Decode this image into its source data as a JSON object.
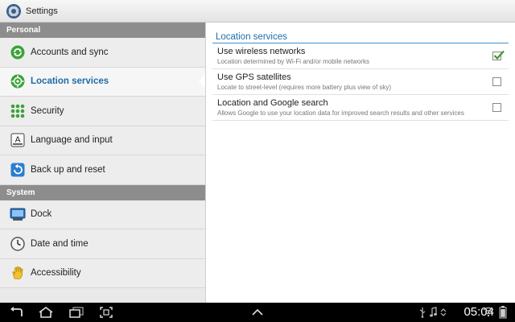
{
  "app": {
    "title": "Settings",
    "icon": "settings-gear-icon"
  },
  "sidebar": {
    "sections": [
      {
        "header": "Personal",
        "items": [
          {
            "label": "Accounts and sync",
            "icon": "sync-icon"
          },
          {
            "label": "Location services",
            "icon": "location-target-icon",
            "selected": true
          },
          {
            "label": "Security",
            "icon": "security-grid-icon"
          },
          {
            "label": "Language and input",
            "icon": "keyboard-a-icon"
          },
          {
            "label": "Back up and reset",
            "icon": "backup-reset-icon"
          }
        ]
      },
      {
        "header": "System",
        "items": [
          {
            "label": "Dock",
            "icon": "dock-icon"
          },
          {
            "label": "Date and time",
            "icon": "clock-icon"
          },
          {
            "label": "Accessibility",
            "icon": "hand-icon"
          }
        ]
      }
    ]
  },
  "main": {
    "title": "Location services",
    "prefs": [
      {
        "title": "Use wireless networks",
        "summary": "Location determined by Wi-Fi and/or mobile networks",
        "checked": true
      },
      {
        "title": "Use GPS satellites",
        "summary": "Locate to street-level (requires more battery plus view of sky)",
        "checked": false
      },
      {
        "title": "Location and Google search",
        "summary": "Allows Google to use your location data for improved search results and other services",
        "checked": false
      }
    ]
  },
  "navbar": {
    "time": "05:04",
    "buttons": [
      "back-icon",
      "home-icon",
      "recent-apps-icon",
      "screenshot-icon",
      "up-chevron-icon"
    ],
    "status_icons": [
      "usb-icon",
      "music-icon",
      "sync-status-icon",
      "wifi-icon",
      "battery-icon"
    ]
  },
  "colors": {
    "accent": "#1e6ca8",
    "section_header": "#8d8d8d",
    "check": "#3f9a2a"
  }
}
